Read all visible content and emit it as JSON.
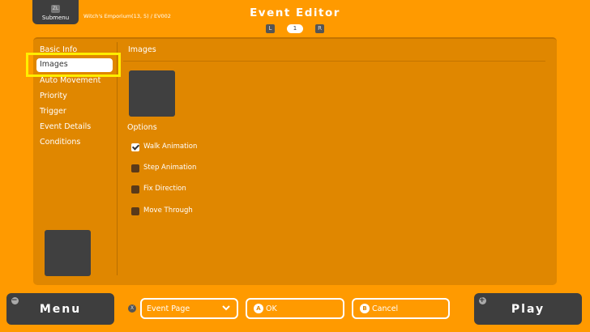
{
  "header": {
    "submenu": {
      "key": "ZL",
      "label": "Submenu"
    },
    "location": "Witch's Emporium(13, 5) / EV002",
    "title": "Event Editor",
    "pages": {
      "left_key": "L",
      "current": "1",
      "right_key": "R"
    }
  },
  "sidebar": {
    "items": [
      {
        "label": "Basic Info"
      },
      {
        "label": "Images"
      },
      {
        "label": "Auto Movement"
      },
      {
        "label": "Priority"
      },
      {
        "label": "Trigger"
      },
      {
        "label": "Event Details"
      },
      {
        "label": "Conditions"
      }
    ],
    "selected": "Images"
  },
  "content": {
    "title": "Images",
    "options_label": "Options",
    "options": [
      {
        "label": "Walk Animation",
        "checked": true
      },
      {
        "label": "Step Animation",
        "checked": false
      },
      {
        "label": "Fix Direction",
        "checked": false
      },
      {
        "label": "Move Through",
        "checked": false
      }
    ]
  },
  "footer": {
    "menu": {
      "key": "−",
      "label": "Menu"
    },
    "event_page": {
      "key": "X",
      "label": "Event Page"
    },
    "ok": {
      "key": "A",
      "label": "OK"
    },
    "cancel": {
      "key": "B",
      "label": "Cancel"
    },
    "play": {
      "key": "+",
      "label": "Play"
    }
  },
  "colors": {
    "background": "#ff9a00",
    "panel": "#e08700",
    "highlight": "#ffee00",
    "dark_button": "#3e3e3e"
  }
}
